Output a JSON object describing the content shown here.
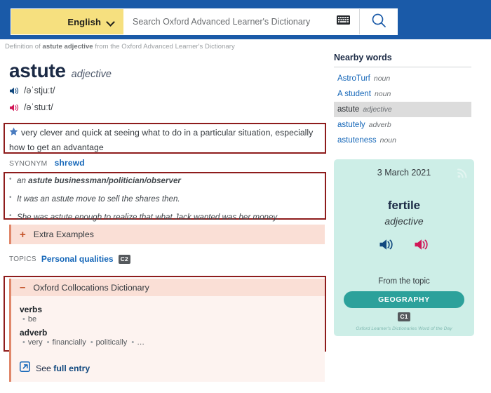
{
  "colors": {
    "header_blue": "#1a5aa8",
    "lang_yellow": "#f6e07f",
    "link_blue": "#1466b8",
    "highlight_red": "#8e1c1c",
    "panel_peach": "#fadfd6",
    "panel_peach_light": "#fdf3f0",
    "accent_orange": "#e0876a",
    "wotd_mint": "#cdeee7",
    "wotd_teal": "#2ca19b",
    "cefr_grey": "#55595d",
    "uk_speaker": "#12497f",
    "us_speaker": "#d11757"
  },
  "header": {
    "language_label": "English",
    "chevron_icon": "chevron-down-icon",
    "search": {
      "placeholder": "Search Oxford Advanced Learner's Dictionary",
      "value": ""
    },
    "keyboard_icon": "keyboard-icon",
    "search_icon": "search-icon"
  },
  "breadcrumb": {
    "prefix": "Definition of",
    "term": "astute adjective",
    "suffix": "from the Oxford Advanced Learner's Dictionary"
  },
  "entry": {
    "headword": "astute",
    "part_of_speech": "adjective",
    "pronunciations": [
      {
        "accent": "uk",
        "speaker_icon": "speaker-icon-uk",
        "ipa": "/əˈstjuːt/"
      },
      {
        "accent": "us",
        "speaker_icon": "speaker-icon-us",
        "ipa": "/əˈstuːt/"
      }
    ],
    "definition": {
      "star_icon": "star-icon",
      "text": "very clever and quick at seeing what to do in a particular situation, especially how to get an advantage"
    },
    "synonym": {
      "label": "SYNONYM",
      "word": "shrewd"
    },
    "examples": [
      {
        "plain_prefix": "an ",
        "bold": "astute businessman/politician/observer",
        "plain_suffix": ""
      },
      {
        "plain_prefix": "It was an astute move to sell the shares then.",
        "bold": "",
        "plain_suffix": ""
      },
      {
        "plain_prefix": "She was astute enough to realize that what Jack wanted was her money.",
        "bold": "",
        "plain_suffix": ""
      }
    ],
    "extra_examples": {
      "toggle_icon": "plus-icon",
      "label": "Extra Examples"
    },
    "topics": {
      "label": "TOPICS",
      "link": "Personal qualities",
      "cefr": "C2"
    },
    "collocations": {
      "toggle_icon": "minus-icon",
      "title": "Oxford Collocations Dictionary",
      "groups": [
        {
          "category": "verbs",
          "words": [
            "be"
          ]
        },
        {
          "category": "adverb",
          "words": [
            "very",
            "financially",
            "politically",
            "…"
          ]
        }
      ]
    },
    "full_entry": {
      "icon": "external-link-icon",
      "text_prefix": "See ",
      "text_link": "full entry"
    }
  },
  "sidebar": {
    "nearby_title": "Nearby words",
    "nearby_words": [
      {
        "word": "AstroTurf",
        "pos": "noun",
        "current": false
      },
      {
        "word": "A student",
        "pos": "noun",
        "current": false
      },
      {
        "word": "astute",
        "pos": "adjective",
        "current": true
      },
      {
        "word": "astutely",
        "pos": "adverb",
        "current": false
      },
      {
        "word": "astuteness",
        "pos": "noun",
        "current": false
      }
    ],
    "word_of_the_day": {
      "date": "3 March 2021",
      "rss_icon": "rss-icon",
      "word": "fertile",
      "part_of_speech": "adjective",
      "speakers": [
        {
          "accent": "uk",
          "icon": "speaker-icon-uk"
        },
        {
          "accent": "us",
          "icon": "speaker-icon-us"
        }
      ],
      "from_topic_label": "From the topic",
      "topic": "GEOGRAPHY",
      "cefr": "C1",
      "footer": "Oxford Learner's Dictionaries Word of the Day"
    }
  }
}
